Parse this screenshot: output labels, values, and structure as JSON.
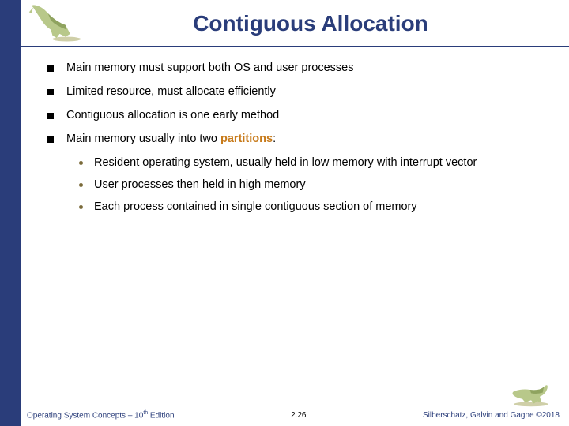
{
  "title": "Contiguous Allocation",
  "bullets": [
    "Main memory must support both OS and user processes",
    "Limited resource, must allocate efficiently",
    "Contiguous allocation is one early method"
  ],
  "bullet4_prefix": "Main memory usually into two ",
  "bullet4_hl": "partitions",
  "bullet4_suffix": ":",
  "sub": [
    "Resident operating system, usually held in low memory with interrupt vector",
    "User processes then held in high memory",
    "Each process contained in single contiguous section of memory"
  ],
  "footer": {
    "left_a": "Operating System Concepts – 10",
    "left_sup": "th",
    "left_b": " Edition",
    "mid": "2.26",
    "right_a": "Silberschatz, Galvin and Gagne ",
    "right_b": "©",
    "right_c": "2018"
  }
}
